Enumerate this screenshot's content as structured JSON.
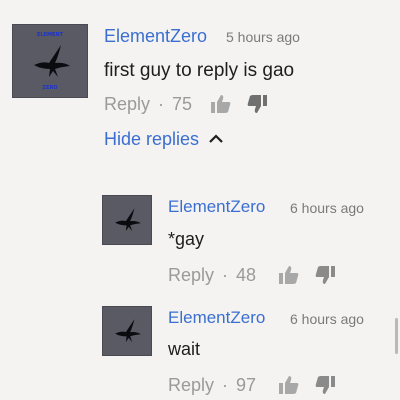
{
  "comments": [
    {
      "author": "ElementZero",
      "time": "5 hours ago",
      "text": "first guy to reply is gao",
      "reply_label": "Reply",
      "likes": "75",
      "avatar_top": "ELEMENT",
      "avatar_bottom": "ZERO"
    }
  ],
  "hide_replies_label": "Hide replies",
  "replies": [
    {
      "author": "ElementZero",
      "time": "6 hours ago",
      "text": "*gay",
      "reply_label": "Reply",
      "likes": "48"
    },
    {
      "author": "ElementZero",
      "time": "6 hours ago",
      "text": "wait",
      "reply_label": "Reply",
      "likes": "97"
    }
  ],
  "colors": {
    "author": "#3a6fd0",
    "link": "#3a6fd0",
    "text": "#1e1e1e",
    "muted": "#9a9a9a",
    "background": "#f4f3f2"
  },
  "icons": [
    "thumbs-up-icon",
    "thumbs-down-icon",
    "chevron-up-icon",
    "bird-logo-icon"
  ]
}
